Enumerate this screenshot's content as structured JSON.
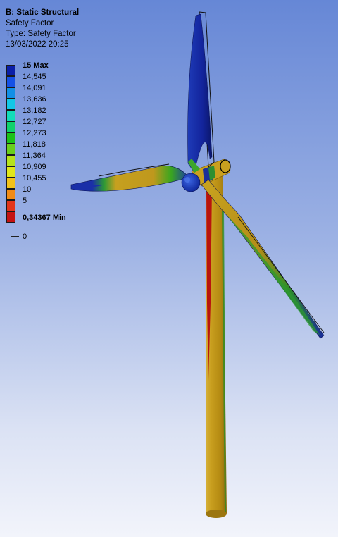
{
  "header": {
    "title": "B: Static Structural",
    "result": "Safety Factor",
    "type": "Type: Safety Factor",
    "timestamp": "13/03/2022 20:25"
  },
  "legend": {
    "max_label": "15 Max",
    "min_label": "0,34367 Min",
    "zero_label": "0",
    "labels": [
      "14,545",
      "14,091",
      "13,636",
      "13,182",
      "12,727",
      "12,273",
      "11,818",
      "11,364",
      "10,909",
      "10,455",
      "10",
      "5"
    ],
    "colors": [
      "#0b1fa8",
      "#1551e6",
      "#118fe6",
      "#12c7e6",
      "#12dcb8",
      "#0fd26c",
      "#1bc218",
      "#69cf1b",
      "#b6e21c",
      "#e0e619",
      "#f2c21a",
      "#f08b16",
      "#e2351a",
      "#c41212"
    ]
  },
  "colors": {
    "tower": "#c49a1c",
    "tower_shade": "#8f6b0d",
    "tower_red": "#b8140e",
    "blade_blue": "#14279c",
    "blade_yellow": "#c9a21f",
    "green": "#3fb11c"
  }
}
